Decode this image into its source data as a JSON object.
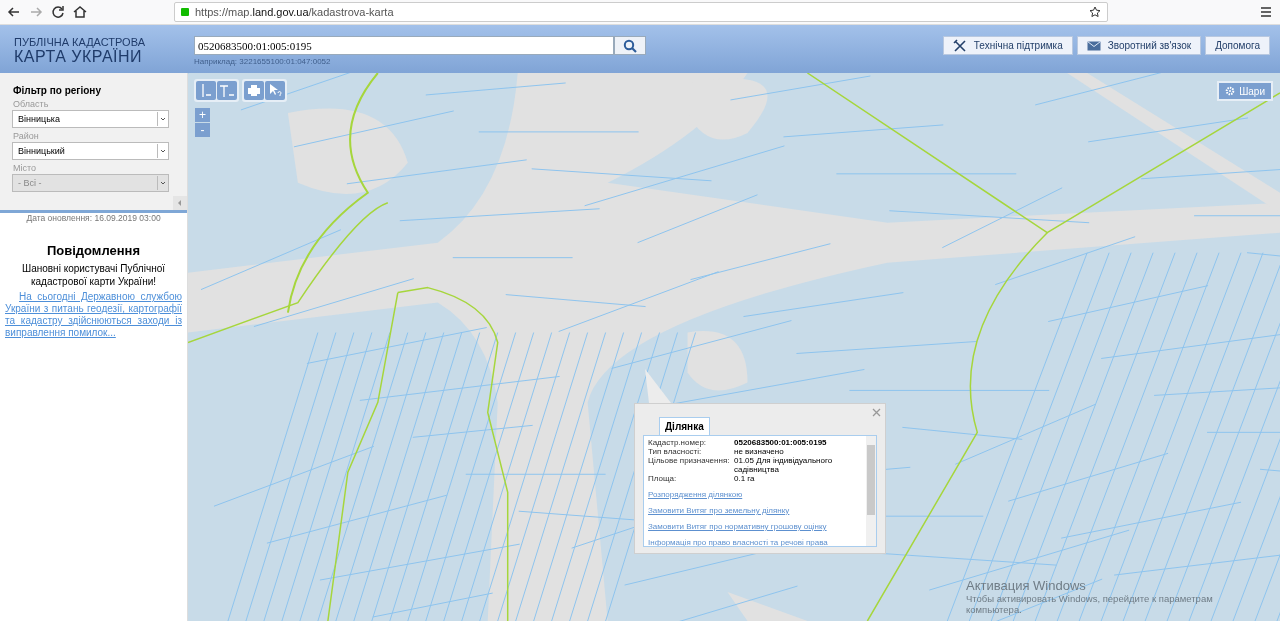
{
  "browser": {
    "url_prefix": "https://map.",
    "url_domain": "land.gov.ua",
    "url_path": "/kadastrova-karta"
  },
  "header": {
    "title_top": "ПУБЛІЧНА КАДАСТРОВА",
    "title_main": "КАРТА УКРАЇНИ",
    "search": {
      "value": "0520683500:01:005:0195"
    },
    "hint": "Наприклад: 3221655100:01:047:0052",
    "buttons": [
      {
        "kind": "tools",
        "label": "Технічна підтримка"
      },
      {
        "kind": "mail",
        "label": "Зворотний зв'язок"
      },
      {
        "kind": "plain",
        "label": "Допомога"
      }
    ]
  },
  "filter": {
    "title": "Фільтр по регіону",
    "fields": [
      {
        "label": "Область",
        "value": "Вінницька",
        "disabled": false
      },
      {
        "label": "Район",
        "value": "Вінницький",
        "disabled": false
      },
      {
        "label": "Місто",
        "value": "- Всі -",
        "disabled": true
      }
    ]
  },
  "update_date": "Дата оновлення: 16.09.2019 03:00",
  "notice": {
    "title": "Повідомлення",
    "greeting": "Шановні користувачі Публічної кадастрової карти України!",
    "link": "На сьогодні Державною службою України з питань геодезії, картографії та кадастру здійснюються заходи із виправлення помилок..."
  },
  "map": {
    "layers_button": "Шари",
    "zoom_in": "+",
    "zoom_out": "-"
  },
  "popup": {
    "tab": "Ділянка",
    "rows": [
      {
        "label": "Кадастр.номер:",
        "value": "0520683500:01:005:0195",
        "bold": true
      },
      {
        "label": "Тип власності:",
        "value": "не визначено",
        "bold": false
      },
      {
        "label": "Цільове призначення:",
        "value": "01.05 Для індивідуального садівництва",
        "bold": false
      },
      {
        "label": "Площа:",
        "value": "0.1 га",
        "bold": false
      }
    ],
    "links": [
      "Розпорядження ділянкою",
      "Замовити Витяг про земельну ділянку",
      "Замовити Витяг про нормативну грошову оцінку",
      "Інформація про право власності та речові права"
    ]
  },
  "os_notice": {
    "title": "Активация Windows",
    "text": "Чтобы активировать Windows, перейдите к параметрам компьютера."
  }
}
